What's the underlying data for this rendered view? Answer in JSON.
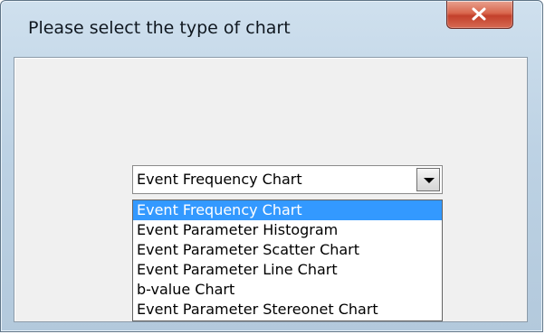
{
  "window": {
    "title": "Please select the type of chart",
    "close_icon": "close-icon"
  },
  "combo": {
    "selected_value": "Event Frequency Chart",
    "arrow_icon": "chevron-down-icon"
  },
  "dropdown": {
    "items": [
      "Event Frequency Chart",
      "Event Parameter Histogram",
      "Event Parameter Scatter Chart",
      "Event Parameter Line Chart",
      "b-value Chart",
      "Event Parameter Stereonet Chart"
    ],
    "highlighted_index": 0
  },
  "colors": {
    "highlight": "#3399ff",
    "close_button": "#c3402b"
  }
}
